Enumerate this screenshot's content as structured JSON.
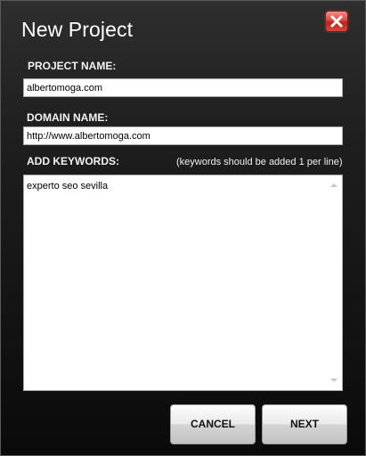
{
  "dialog": {
    "title": "New Project"
  },
  "close_button": {
    "icon": "close-icon"
  },
  "project_name": {
    "label": "PROJECT NAME:",
    "value": "albertomoga.com"
  },
  "domain_name": {
    "label": "DOMAIN NAME:",
    "value": "http://www.albertomoga.com"
  },
  "keywords": {
    "label": "ADD KEYWORDS:",
    "hint": "(keywords should be added 1 per line)",
    "value": "experto seo sevilla"
  },
  "buttons": {
    "cancel_label": "CANCEL",
    "next_label": "NEXT"
  },
  "colors": {
    "close_button": "#d9362e",
    "background_top": "#2e2e2e",
    "background_bottom": "#0a0a0a"
  }
}
